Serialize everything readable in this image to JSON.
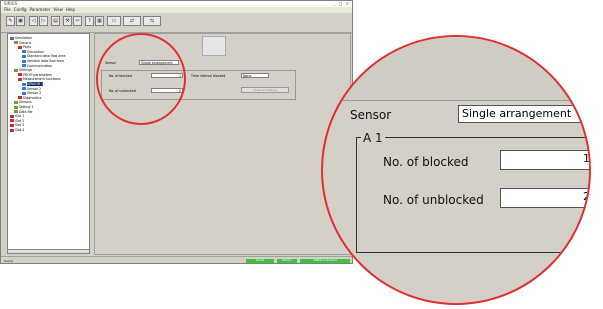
{
  "window": {
    "title": "SIRIUS",
    "controls": "_ □ ×",
    "menu": [
      "File",
      "Config",
      "Parameter",
      "View",
      "Help"
    ]
  },
  "tree": {
    "items": [
      {
        "label": "Simulation",
        "depth": 0
      },
      {
        "label": "Generic",
        "depth": 1
      },
      {
        "label": "Ports",
        "depth": 2
      },
      {
        "label": "Simulation",
        "depth": 3
      },
      {
        "label": "Standard data flow area",
        "depth": 3
      },
      {
        "label": "Variable data flow area",
        "depth": 3
      },
      {
        "label": "Communication",
        "depth": 3
      },
      {
        "label": "Settings",
        "depth": 1
      },
      {
        "label": "PROFI parameters",
        "depth": 2
      },
      {
        "label": "Measurement functions",
        "depth": 2
      },
      {
        "label": "SENSOR 1",
        "depth": 3
      },
      {
        "label": "Sensor 2",
        "depth": 3
      },
      {
        "label": "Sensor 3",
        "depth": 3
      },
      {
        "label": "Diagnostics",
        "depth": 2
      },
      {
        "label": "Sensors",
        "depth": 1
      },
      {
        "label": "Setting 1",
        "depth": 1
      },
      {
        "label": "Data file",
        "depth": 1
      },
      {
        "label": "Slot 1",
        "depth": 0
      },
      {
        "label": "Slot 2",
        "depth": 0
      },
      {
        "label": "Slot 3",
        "depth": 0
      },
      {
        "label": "Slot 4",
        "depth": 0
      }
    ]
  },
  "status": {
    "text": "Ready",
    "panels": [
      "Online",
      "Mode 1",
      "SIRIUS connected"
    ]
  },
  "form": {
    "sensor_label": "Sensor",
    "sensor_value": "Single arrangement",
    "group_label": "A 1",
    "blocked_label": "No. of blocked",
    "blocked_value": "1",
    "unblocked_label": "No. of unblocked",
    "unblocked_value": "2",
    "extra_label": "Time interval blocked",
    "extra_value": "None",
    "extra_button": "Advanced settings"
  },
  "colors": {
    "highlight_ring": "#e03030",
    "status_ok": "#3fc33f",
    "window_bg": "#d4d0c8"
  }
}
